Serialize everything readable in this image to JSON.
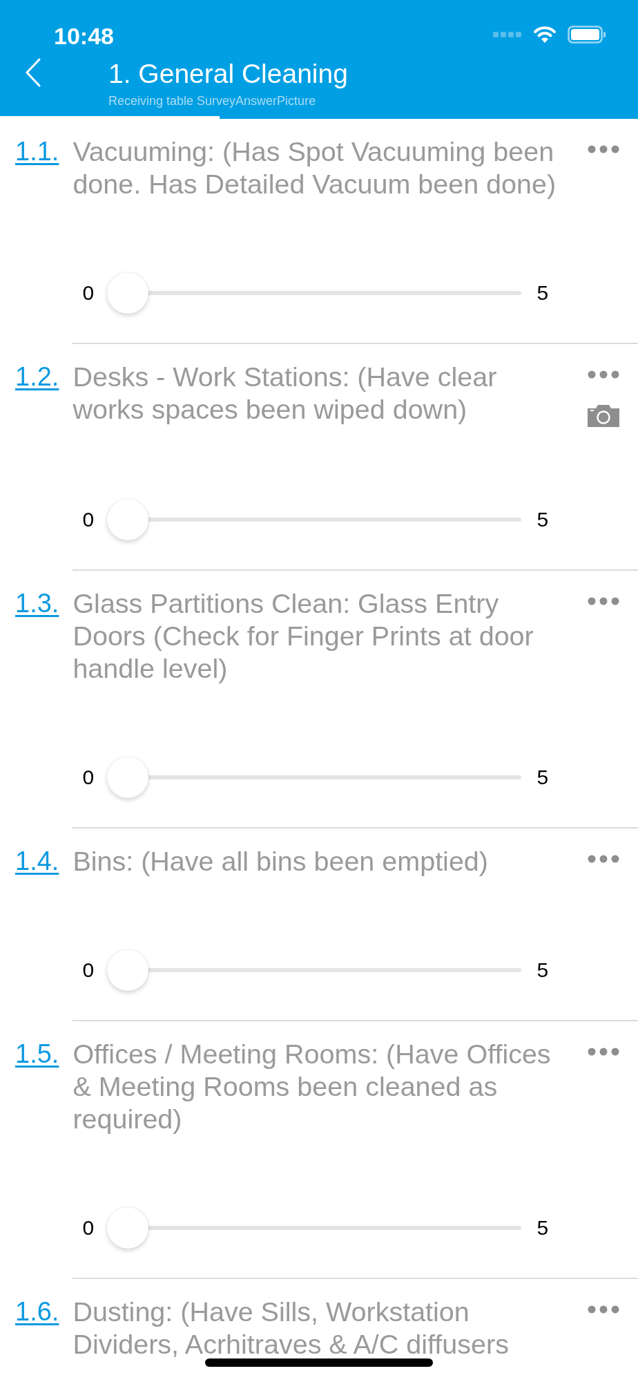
{
  "status_bar": {
    "time": "10:48"
  },
  "header": {
    "title": "1. General Cleaning",
    "subtitle": "Receiving table SurveyAnswerPicture",
    "progress": {
      "level": 0.344
    }
  },
  "items": [
    {
      "number": "1.1.",
      "text": "Vacuuming: (Has Spot Vacuuming been done. Has Detailed Vacuum been done)",
      "has_camera": false,
      "slider": {
        "min": "0",
        "max": "5",
        "level": 0
      }
    },
    {
      "number": "1.2.",
      "text": "Desks - Work Stations: (Have clear works spaces been wiped down)",
      "has_camera": true,
      "slider": {
        "min": "0",
        "max": "5",
        "level": 0
      }
    },
    {
      "number": "1.3.",
      "text": "Glass Partitions Clean: Glass Entry Doors (Check for Finger Prints at door handle level)",
      "has_camera": false,
      "slider": {
        "min": "0",
        "max": "5",
        "level": 0
      }
    },
    {
      "number": "1.4.",
      "text": "Bins: (Have all bins been emptied)",
      "has_camera": false,
      "slider": {
        "min": "0",
        "max": "5",
        "level": 0
      }
    },
    {
      "number": "1.5.",
      "text": "Offices / Meeting Rooms: (Have Offices & Meeting Rooms been cleaned as required)",
      "has_camera": false,
      "slider": {
        "min": "0",
        "max": "5",
        "level": 0
      }
    },
    {
      "number": "1.6.",
      "text": "Dusting: (Have Sills, Workstation Dividers, Acrhitraves & A/C diffusers",
      "has_camera": false
    }
  ]
}
